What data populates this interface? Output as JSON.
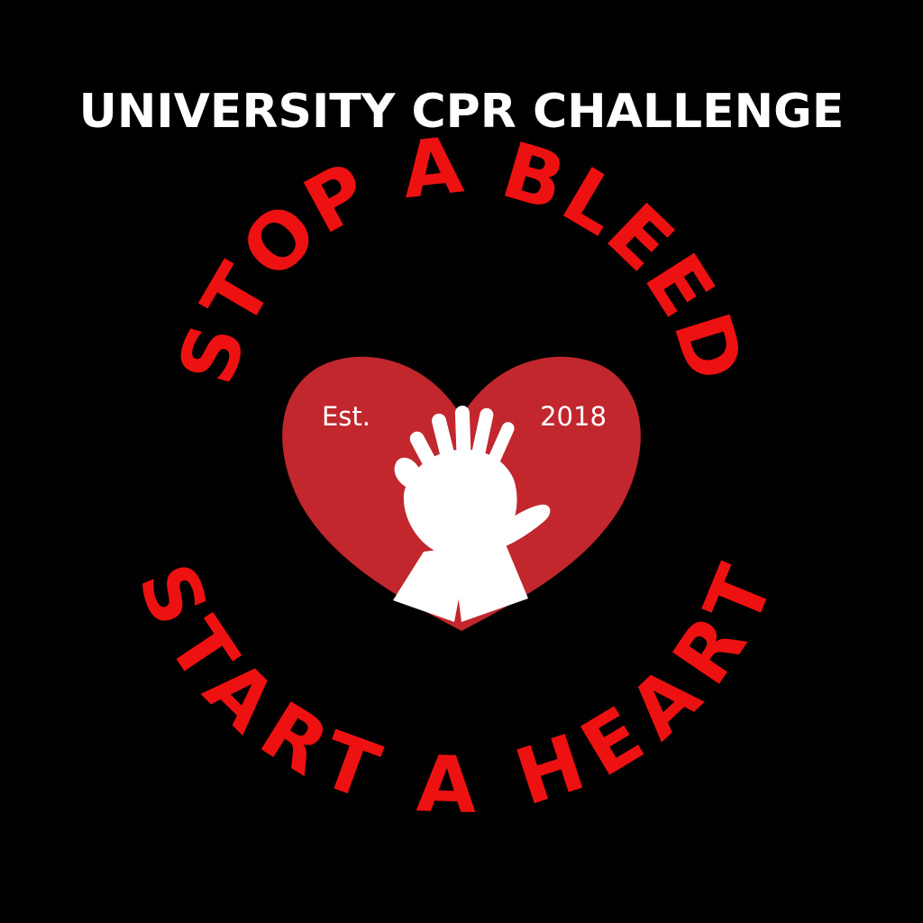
{
  "header": {
    "title": "UNIVERSITY CPR CHALLENGE"
  },
  "logo": {
    "top_arc_text": "STOP A BLEED",
    "bottom_arc_text": "START A HEART",
    "heart_left_label": "Est.",
    "heart_right_label": "2018",
    "center_icon": "cpr-hands-icon"
  },
  "colors": {
    "background": "#000000",
    "title": "#ffffff",
    "arc_text": "#ee1111",
    "heart": "#c1272d",
    "hands": "#ffffff",
    "heart_labels": "#ffffff"
  }
}
